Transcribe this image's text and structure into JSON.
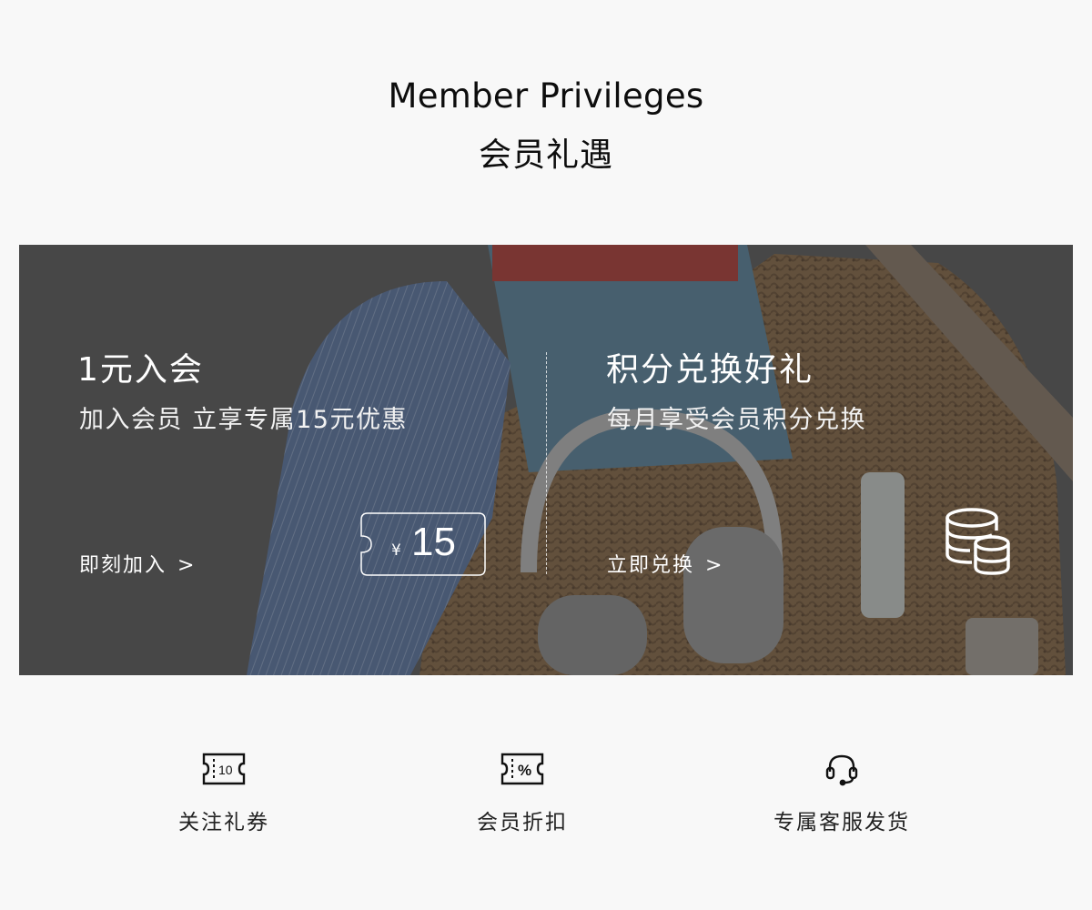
{
  "header": {
    "title_en": "Member Privileges",
    "title_zh": "会员礼遇"
  },
  "banner": {
    "left_card": {
      "title": "1元入会",
      "subtitle": "加入会员 立享专属15元优惠",
      "cta": "即刻加入",
      "cta_arrow": ">",
      "coupon_currency": "¥",
      "coupon_amount": "15"
    },
    "right_card": {
      "title": "积分兑换好礼",
      "subtitle": "每月享受会员积分兑换",
      "cta": "立即兑换",
      "cta_arrow": ">",
      "icon": "database-icon"
    }
  },
  "features": [
    {
      "label": "关注礼券",
      "icon": "ticket-10-icon",
      "icon_text": "10"
    },
    {
      "label": "会员折扣",
      "icon": "ticket-percent-icon",
      "icon_text": "%"
    },
    {
      "label": "专属客服发货",
      "icon": "headset-icon"
    }
  ],
  "colors": {
    "page_bg": "#f8f8f8",
    "banner_overlay": "#3a3a3a",
    "text_dark": "#111111",
    "text_light": "#ffffff"
  }
}
